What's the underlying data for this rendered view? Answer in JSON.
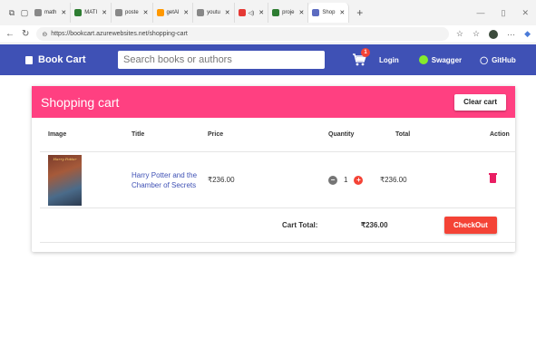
{
  "browser": {
    "tabs": [
      {
        "label": "math",
        "fav_color": "#888888"
      },
      {
        "label": "MATI",
        "fav_color": "#2e7d32"
      },
      {
        "label": "poste",
        "fav_color": "#888888"
      },
      {
        "label": "getAl",
        "fav_color": "#ff9800"
      },
      {
        "label": "youtu",
        "fav_color": "#888888"
      },
      {
        "label": "",
        "fav_color": "#e53935"
      },
      {
        "label": "proje",
        "fav_color": "#2e7d32"
      },
      {
        "label": "Shop",
        "fav_color": "#5c6bc0"
      }
    ],
    "url": "https://bookcart.azurewebsites.net/shopping-cart"
  },
  "appbar": {
    "brand": "Book Cart",
    "search_placeholder": "Search books or authors",
    "cart_count": "1",
    "login": "Login",
    "swagger": "Swagger",
    "github": "GitHub",
    "bg_color": "#3f51b5"
  },
  "cart": {
    "title": "Shopping cart",
    "clear_label": "Clear cart",
    "columns": [
      "Image",
      "Title",
      "Price",
      "Quantity",
      "Total",
      "Action"
    ],
    "items": [
      {
        "cover_text": "Harry Potter",
        "title": "Harry Potter and the Chamber of Secrets",
        "price": "₹236.00",
        "quantity": "1",
        "total": "₹236.00"
      }
    ],
    "total_label": "Cart Total:",
    "total_value": "₹236.00",
    "checkout_label": "CheckOut",
    "header_color": "#ff4081"
  }
}
